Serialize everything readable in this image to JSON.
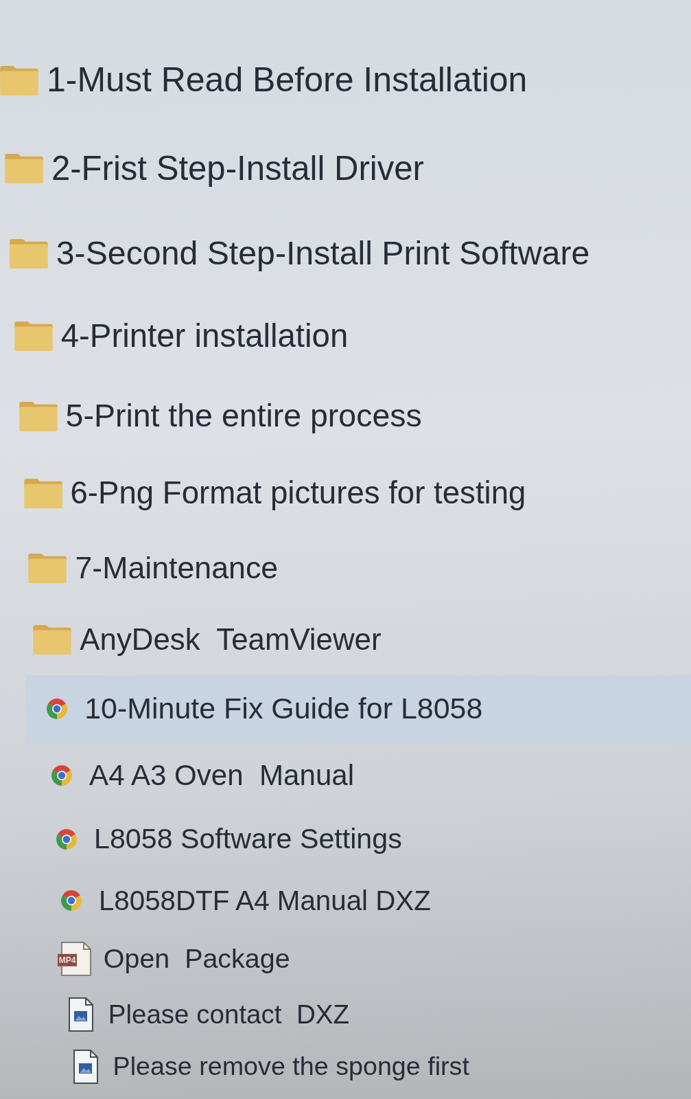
{
  "file_list": {
    "items": [
      {
        "kind": "folder",
        "name": "1-Must Read Before Installation",
        "selected": false
      },
      {
        "kind": "folder",
        "name": "2-Frist Step-Install Driver",
        "selected": false
      },
      {
        "kind": "folder",
        "name": "3-Second Step-Install Print Software",
        "selected": false
      },
      {
        "kind": "folder",
        "name": "4-Printer installation",
        "selected": false
      },
      {
        "kind": "folder",
        "name": "5-Print the entire process",
        "selected": false
      },
      {
        "kind": "folder",
        "name": "6-Png Format pictures for testing",
        "selected": false
      },
      {
        "kind": "folder",
        "name": "7-Maintenance",
        "selected": false
      },
      {
        "kind": "folder",
        "name": "AnyDesk  TeamViewer",
        "selected": false
      },
      {
        "kind": "web",
        "name": "10-Minute Fix Guide for L8058",
        "selected": true
      },
      {
        "kind": "web",
        "name": "A4 A3 Oven  Manual",
        "selected": false
      },
      {
        "kind": "web",
        "name": "L8058 Software Settings",
        "selected": false
      },
      {
        "kind": "web",
        "name": "L8058DTF A4 Manual DXZ",
        "selected": false
      },
      {
        "kind": "video",
        "type_label": "MP4",
        "name": "Open  Package",
        "selected": false
      },
      {
        "kind": "image",
        "name": "Please contact  DXZ",
        "selected": false
      },
      {
        "kind": "image",
        "name": "Please remove the sponge first",
        "selected": false
      }
    ]
  }
}
